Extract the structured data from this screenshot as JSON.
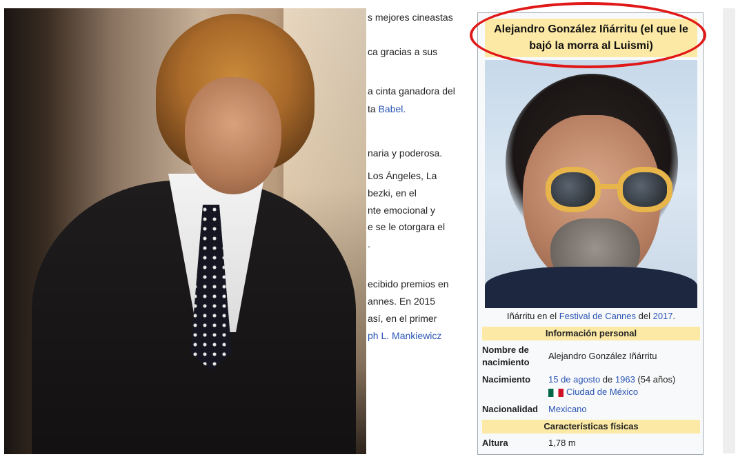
{
  "article_lines": [
    "s mejores cineastas",
    "ca gracias a sus",
    "a cinta ganadora del",
    "ta ",
    "naria y poderosa.",
    " Los Ángeles, La",
    "bezki, en el",
    "nte emocional y",
    "e se le otorgara el",
    ".",
    "ecibido premios en",
    "annes. En 2015",
    " así, en el primer",
    "ph L. Mankiewicz"
  ],
  "article_link_babel": "Babel.",
  "infobox": {
    "title": "Alejandro González Iñárritu (el que le bajó la morra al Luismi)",
    "caption_prefix": "Iñárritu en el ",
    "caption_link1": "Festival de Cannes",
    "caption_mid": " del ",
    "caption_link2": "2017",
    "caption_suffix": ".",
    "section_personal": "Información personal",
    "birth_name_label": "Nombre de nacimiento",
    "birth_name_value": "Alejandro González Iñárritu",
    "birth_label": "Nacimiento",
    "birth_date_link": "15 de agosto",
    "birth_de": " de ",
    "birth_year_link": "1963",
    "birth_age": " (54 años)",
    "birth_place_link": "Ciudad de México",
    "nationality_label": "Nacionalidad",
    "nationality_value": "Mexicano",
    "section_physical": "Características físicas",
    "height_label": "Altura",
    "height_value": "1,78 m"
  },
  "colors": {
    "link": "#2a55b5",
    "header_bg": "#fbe9a5",
    "annotation": "#e01818"
  }
}
